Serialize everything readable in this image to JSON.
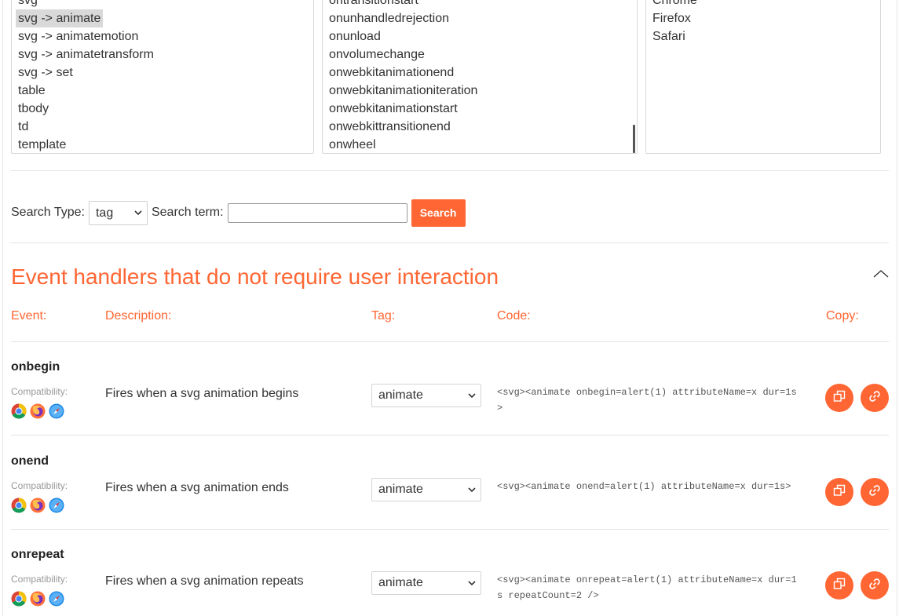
{
  "tag_list": {
    "items": [
      "svg",
      "svg -> animate",
      "svg -> animatemotion",
      "svg -> animatetransform",
      "svg -> set",
      "table",
      "tbody",
      "td",
      "template"
    ],
    "selected": "svg -> animate"
  },
  "event_list": {
    "items": [
      "ontransitionstart",
      "onunhandledrejection",
      "onunload",
      "onvolumechange",
      "onwebkitanimationend",
      "onwebkitanimationiteration",
      "onwebkitanimationstart",
      "onwebkittransitionend",
      "onwheel"
    ]
  },
  "browser_list": {
    "items": [
      "Chrome",
      "Firefox",
      "Safari"
    ]
  },
  "search": {
    "type_label": "Search Type:",
    "type_value": "tag",
    "term_label": "Search term:",
    "term_value": "",
    "button_label": "Search"
  },
  "section": {
    "title": "Event handlers that do not require user interaction",
    "columns": {
      "event": "Event:",
      "description": "Description:",
      "tag": "Tag:",
      "code": "Code:",
      "copy": "Copy:"
    }
  },
  "compat_label": "Compatibility:",
  "rows": [
    {
      "event": "onbegin",
      "description": "Fires when a svg animation begins",
      "tag": "animate",
      "code": "<svg><animate onbegin=alert(1) attributeName=x dur=1s>",
      "browsers": [
        "chrome-icon",
        "firefox-icon",
        "safari-icon"
      ]
    },
    {
      "event": "onend",
      "description": "Fires when a svg animation ends",
      "tag": "animate",
      "code": "<svg><animate onend=alert(1) attributeName=x dur=1s>",
      "browsers": [
        "chrome-icon",
        "firefox-icon",
        "safari-icon"
      ]
    },
    {
      "event": "onrepeat",
      "description": "Fires when a svg animation repeats",
      "tag": "animate",
      "code": "<svg><animate onrepeat=alert(1) attributeName=x dur=1s repeatCount=2 />",
      "browsers": [
        "chrome-icon",
        "firefox-icon",
        "safari-icon"
      ]
    }
  ],
  "colors": {
    "accent": "#ff6633",
    "selected_option_bg": "#d9d9d9",
    "divider": "#e3e3e3"
  }
}
